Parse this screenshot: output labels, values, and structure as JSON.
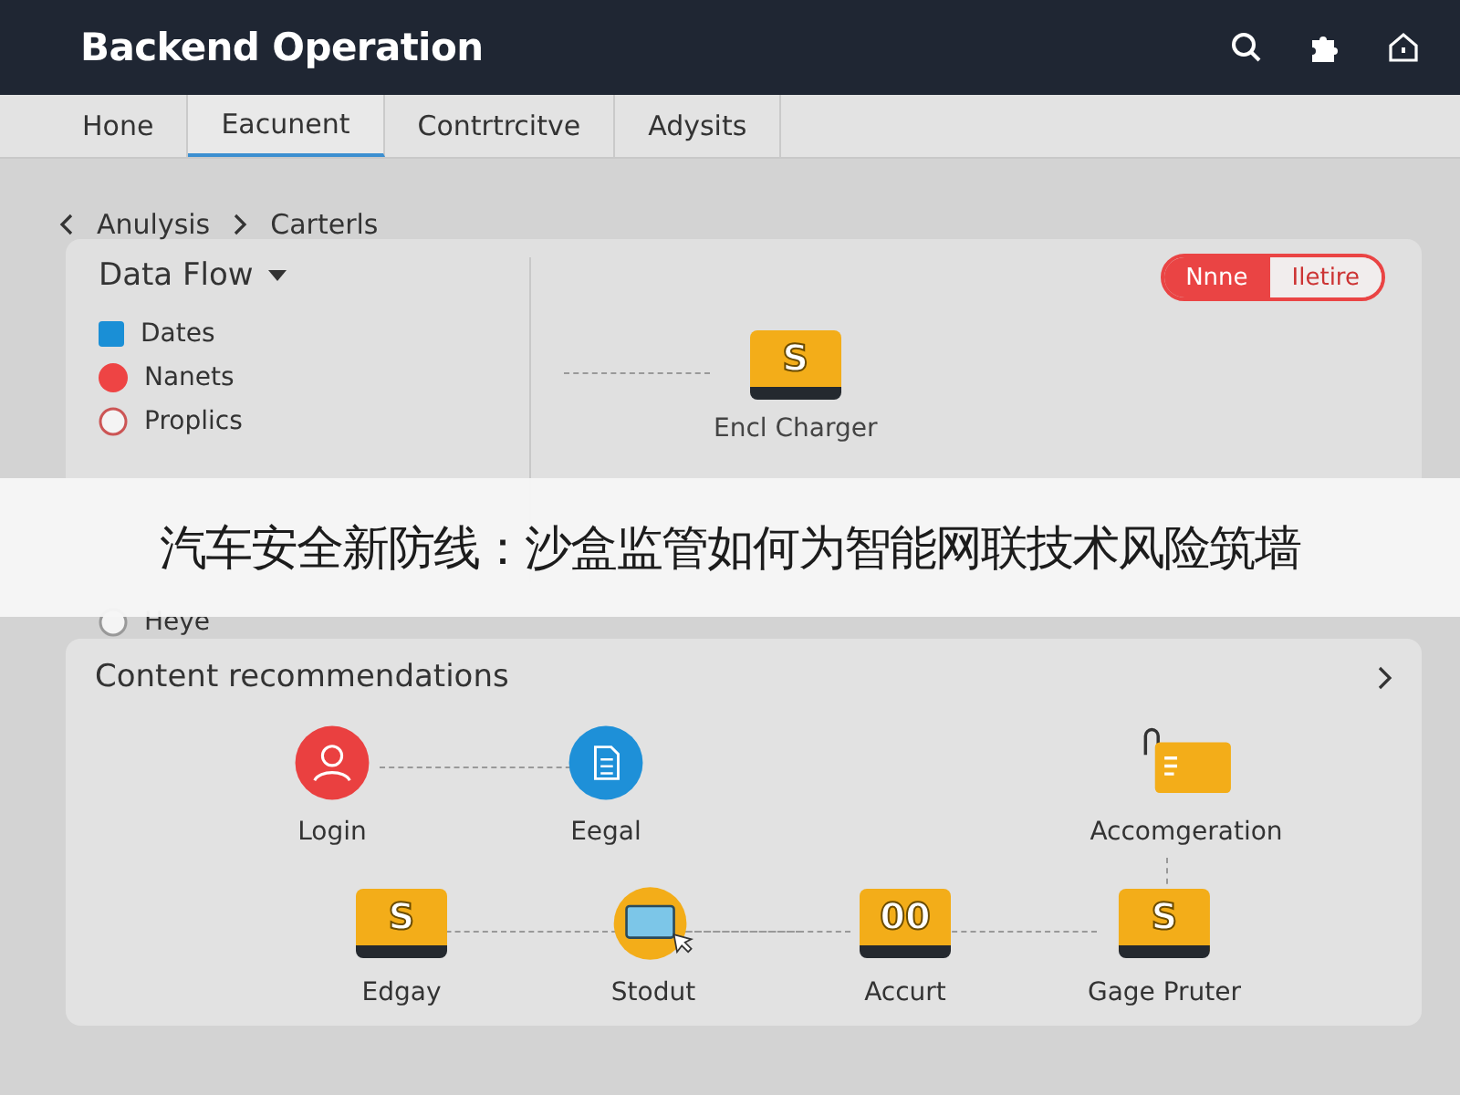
{
  "header": {
    "title": "Backend Operation"
  },
  "tabs": [
    {
      "label": "Hone",
      "selected": false
    },
    {
      "label": "Eacunent",
      "selected": true
    },
    {
      "label": "Contrtrcitve",
      "selected": false
    },
    {
      "label": "Adysits",
      "selected": false
    }
  ],
  "breadcrumb": [
    "Anulysis",
    "Carterls"
  ],
  "data_flow": {
    "title": "Data Flow",
    "legend": [
      {
        "label": "Dates",
        "kind": "square",
        "color": "#1a8fd6"
      },
      {
        "label": "Nanets",
        "kind": "dot",
        "color": "#ee4444"
      },
      {
        "label": "Proplics",
        "kind": "ring",
        "color": "#cc5555"
      },
      {
        "label": "Heye",
        "kind": "ring",
        "color": "#999999"
      }
    ],
    "toggle": [
      {
        "label": "Nnne",
        "selected": true
      },
      {
        "label": "Iletire",
        "selected": false
      }
    ],
    "node": {
      "glyph": "S",
      "label": "Encl Charger"
    }
  },
  "recommendations": {
    "title": "Content recommendations",
    "nodes": [
      {
        "kind": "user",
        "label": "Login"
      },
      {
        "kind": "document",
        "label": "Eegal"
      },
      {
        "kind": "folder",
        "label": "Accomgeration"
      },
      {
        "kind": "tile",
        "glyph": "S",
        "label": "Edgay"
      },
      {
        "kind": "screen",
        "label": "Stodut"
      },
      {
        "kind": "tile",
        "glyph": "00",
        "label": "Accurt"
      },
      {
        "kind": "tile",
        "glyph": "S",
        "label": "Gage Pruter"
      }
    ]
  },
  "banner": {
    "text": "汽车安全新防线：沙盒监管如何为智能网联技术风险筑墙"
  }
}
